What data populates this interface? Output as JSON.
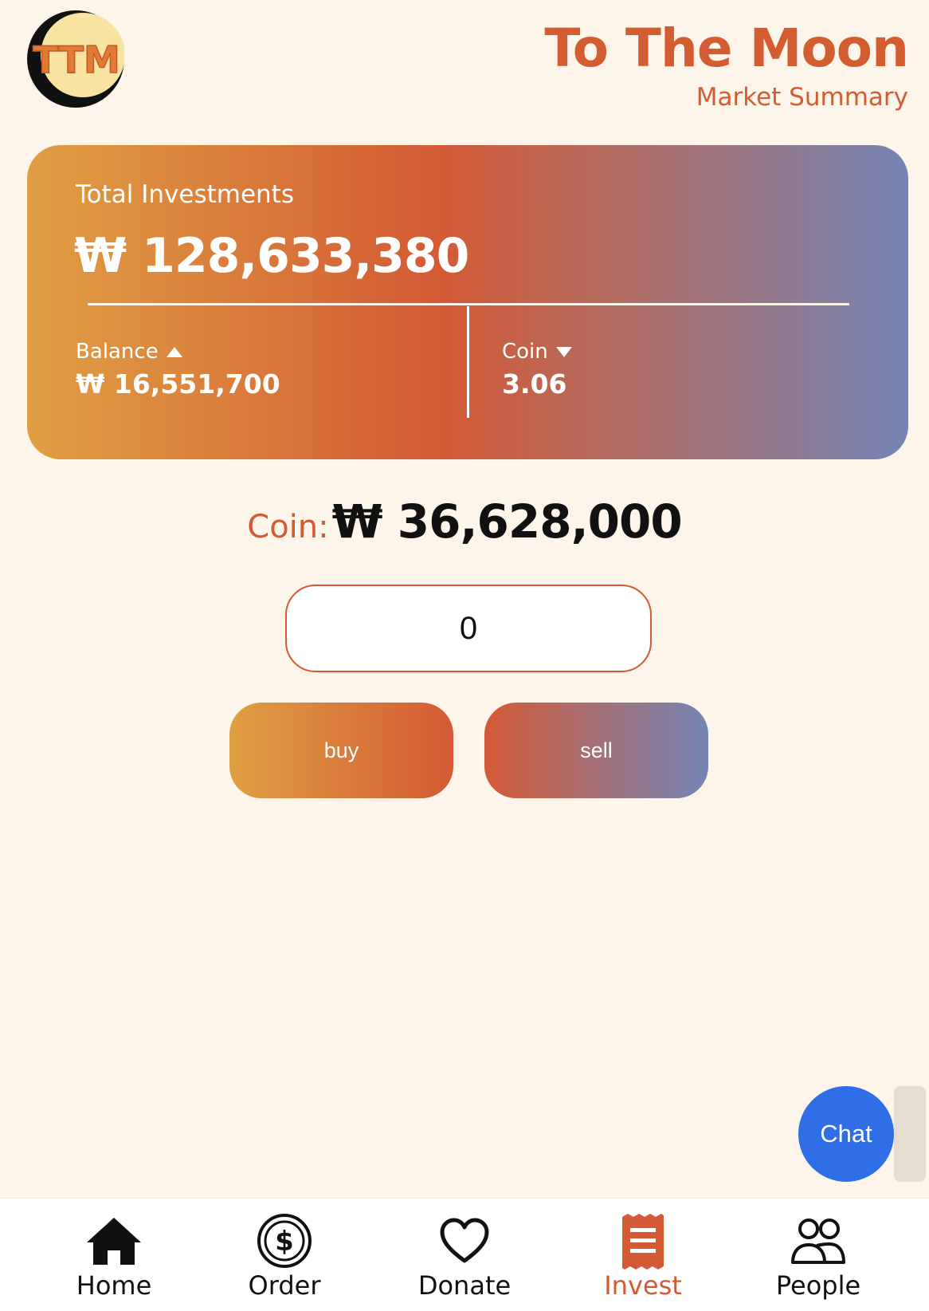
{
  "header": {
    "logo_text": "TTM",
    "title": "To The Moon",
    "subtitle": "Market Summary"
  },
  "summary": {
    "label": "Total Investments",
    "total": "₩ 128,633,380",
    "balance_label": "Balance",
    "balance_value": "₩ 16,551,700",
    "coin_label": "Coin",
    "coin_value": "3.06"
  },
  "price": {
    "label": "Coin:",
    "value": "₩ 36,628,000"
  },
  "trade": {
    "amount_value": "0",
    "buy_label": "buy",
    "sell_label": "sell"
  },
  "chat": {
    "label": "Chat"
  },
  "nav": {
    "items": [
      {
        "label": "Home",
        "icon": "home-icon"
      },
      {
        "label": "Order",
        "icon": "dollar-coin-icon"
      },
      {
        "label": "Donate",
        "icon": "heart-icon"
      },
      {
        "label": "Invest",
        "icon": "receipt-icon",
        "active": true
      },
      {
        "label": "People",
        "icon": "people-icon"
      }
    ]
  },
  "colors": {
    "background": "#fdf5e9",
    "accent": "#d35a35",
    "gradient_start": "#e09f42",
    "gradient_end": "#7585b5",
    "chat": "#2f6ee6"
  }
}
